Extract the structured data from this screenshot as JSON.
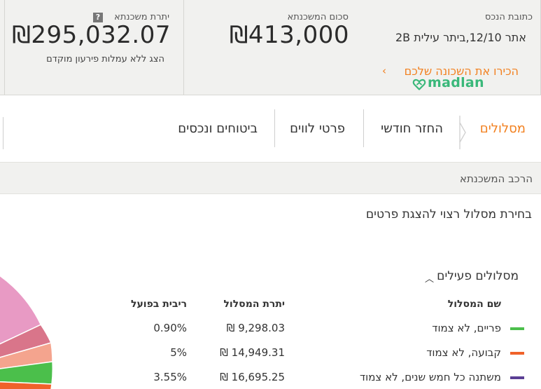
{
  "summary": {
    "address_label": "כתובת הנכס",
    "address_value": "2B אתר 12/10,ביתר עילית",
    "neighborhood_link": "הכירו את השכונה שלכם",
    "madlan_brand": "madlan",
    "mortgage_amount_label": "סכום המשכנתא",
    "mortgage_amount_value": "₪413,000",
    "balance_label": "יתרת משכנתא",
    "balance_help": "?",
    "balance_value": "₪295,032.07",
    "balance_sub": "הצג ללא עמלות פירעון מוקדם"
  },
  "tabs": [
    {
      "label": "מסלולים",
      "active": true
    },
    {
      "label": "החזר חודשי",
      "active": false
    },
    {
      "label": "פרטי לווים",
      "active": false
    },
    {
      "label": "ביטוחים ונכסים",
      "active": false
    }
  ],
  "section": {
    "title": "הרכב המשכנתא",
    "instruction": "בחירת מסלול רצוי להצגת פרטים",
    "active_tracks_label": "מסלולים פעילים"
  },
  "table": {
    "headers": {
      "name": "שם המסלול",
      "balance": "יתרת המסלול",
      "rate": "ריבית בפועל"
    },
    "rows": [
      {
        "name": "פריים, לא צמוד",
        "balance": "₪ 9,298.03",
        "rate": "0.90%",
        "color": "#4bbf4b"
      },
      {
        "name": "קבועה, לא צמוד",
        "balance": "₪ 14,949.31",
        "rate": "5%",
        "color": "#f0622a"
      },
      {
        "name": "משתנה כל חמש שנים, לא צמוד",
        "balance": "₪ 16,695.25",
        "rate": "3.55%",
        "color": "#5b3f94"
      }
    ]
  },
  "colors": {
    "accent": "#f2801f",
    "brand_green": "#3ab87a",
    "pie_pink": "#e89ac4",
    "pie_rose": "#d9758a",
    "pie_salmon": "#f4a48e",
    "pie_green": "#4bbf4b",
    "pie_orange": "#f0622a"
  }
}
